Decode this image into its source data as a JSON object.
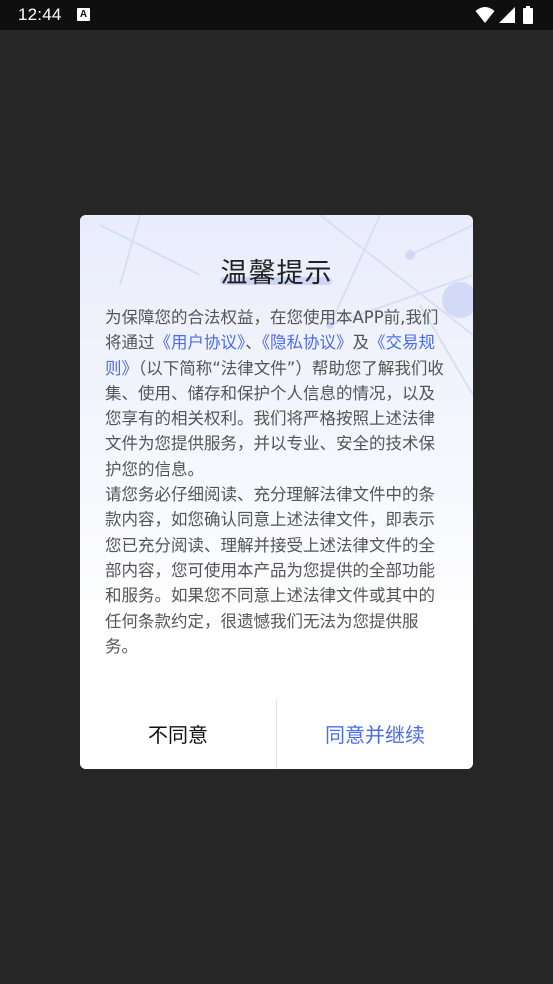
{
  "status_bar": {
    "time": "12:44",
    "notification_glyph": "A",
    "icons": [
      "wifi-icon",
      "signal-icon",
      "battery-icon"
    ]
  },
  "dialog": {
    "title": "温馨提示",
    "paragraph1": {
      "text_1": "为保障您的合法权益，在您使用本APP前,我们将通过",
      "link_user_agreement": "《用户协议》",
      "sep_1": "、",
      "link_privacy_agreement": "《隐私协议》",
      "sep_2": "及",
      "link_trade_rules": "《交易规则》",
      "text_2": "（以下简称“法律文件”）帮助您了解我们收集、使用、储存和保护个人信息的情况，以及您享有的相关权利。我们将严格按照上述法律文件为您提供服务，并以专业、安全的技术保护您的信息。"
    },
    "paragraph2": "请您务必仔细阅读、充分理解法律文件中的条款内容，如您确认同意上述法律文件，即表示您已充分阅读、理解并接受上述法律文件的全部内容，您可使用本产品为您提供的全部功能和服务。如果您不同意上述法律文件或其中的任何条款约定，很遗憾我们无法为您提供服务。",
    "decline_label": "不同意",
    "accept_label": "同意并继续"
  },
  "colors": {
    "link": "#4a6cf0",
    "accept": "#4a6cf0",
    "backdrop": "#262626",
    "status_bar": "#0f0f0f"
  }
}
